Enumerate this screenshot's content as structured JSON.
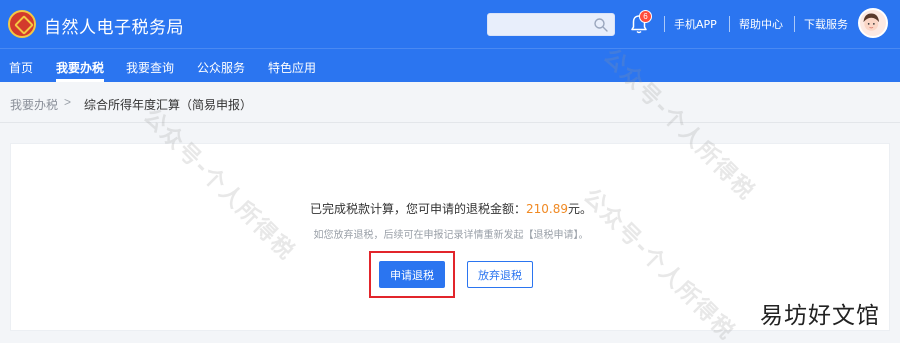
{
  "header": {
    "title": "自然人电子税务局",
    "search_placeholder": "",
    "notification_count": "6",
    "links": [
      "手机APP",
      "帮助中心",
      "下载服务"
    ]
  },
  "nav": {
    "items": [
      "首页",
      "我要办税",
      "我要查询",
      "公众服务",
      "特色应用"
    ],
    "active_index": 1
  },
  "breadcrumb": {
    "parent": "我要办税",
    "separator": ">",
    "current": "综合所得年度汇算（简易申报）"
  },
  "main": {
    "message_prefix": "已完成税款计算，您可申请的退税金额：",
    "refund_amount": "210.89",
    "message_suffix": "元。",
    "hint": "如您放弃退税，后续可在申报记录详情重新发起【退税申请】。",
    "apply_button": "申请退税",
    "give_up_button": "放弃退税"
  },
  "watermark": {
    "text": "公众号-个人所得税",
    "corner_text": "易坊好文馆"
  },
  "colors": {
    "brand": "#2b75f0",
    "amount": "#f08a24",
    "highlight": "#e2252b"
  }
}
